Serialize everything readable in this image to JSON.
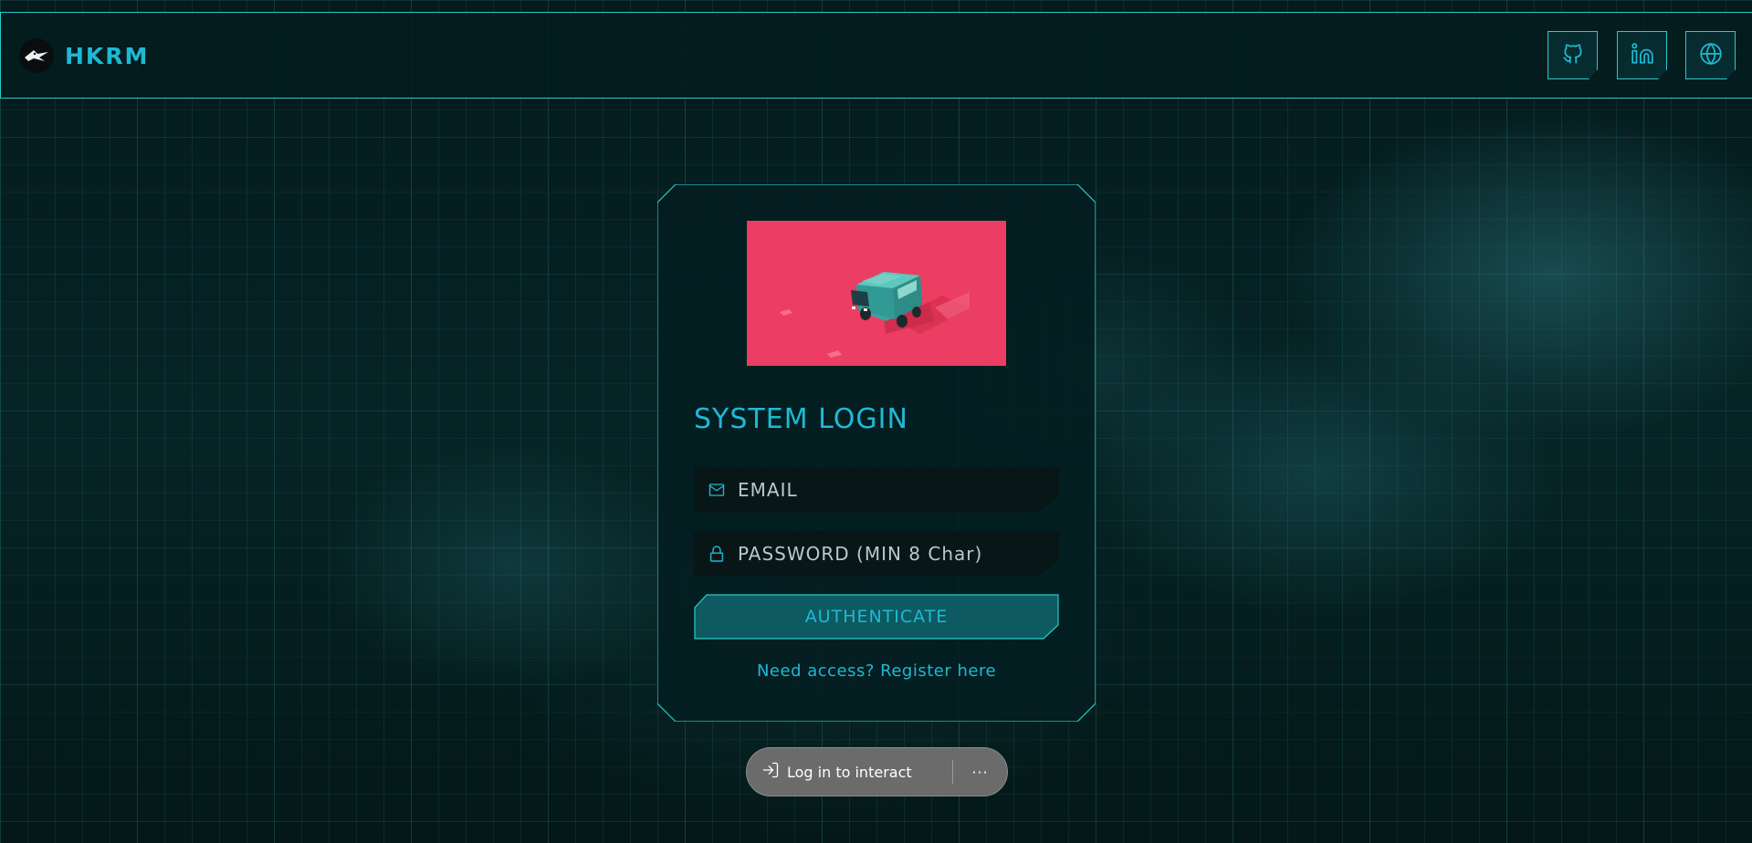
{
  "header": {
    "brand_name": "HKRM",
    "social_links": [
      {
        "icon": "github-icon"
      },
      {
        "icon": "linkedin-icon"
      },
      {
        "icon": "globe-icon"
      }
    ]
  },
  "login": {
    "title": "SYSTEM LOGIN",
    "email_placeholder": "EMAIL",
    "password_placeholder": "PASSWORD (MIN 8 Char)",
    "submit_label": "AUTHENTICATE",
    "register_link": "Need access? Register here"
  },
  "overlay": {
    "login_label": "Log in to interact",
    "more_label": "···"
  },
  "colors": {
    "accent": "#1fb9d4",
    "border": "#2ec9c9",
    "image_background": "#ec3d62",
    "van": "#3aa6a0"
  }
}
